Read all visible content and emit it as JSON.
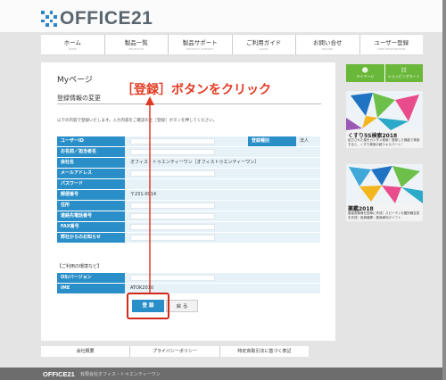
{
  "brand": {
    "logo_text": "OFFICE21",
    "accent": "#2a86c9"
  },
  "nav": {
    "items": [
      {
        "label": "ホーム",
        "sub": "HOME"
      },
      {
        "label": "製品一覧",
        "sub": "PRODUCTS"
      },
      {
        "label": "製品サポート",
        "sub": "PRODUCT SUPPORT"
      },
      {
        "label": "ご利用ガイド",
        "sub": "GUIDE"
      },
      {
        "label": "お問い合せ",
        "sub": "INQUIRY"
      },
      {
        "label": "ユーザー登録",
        "sub": "USER REGISTRATION"
      }
    ]
  },
  "main": {
    "page_title": "Myページ",
    "section_title": "登録情報の変更",
    "intro": "以下の内容で登録いたします。入力内容をご確認の上［登録］ボタンを押してください。",
    "form_rows": [
      {
        "label": "ユーザーID",
        "value": "",
        "input": true
      },
      {
        "label": "お名前／担当者名",
        "value": "",
        "input": true
      },
      {
        "label": "会社名",
        "value": "オフィス・トゥエンティーワン［オフィストゥエンティーワン］",
        "input": false
      },
      {
        "label": "メールアドレス",
        "value": "",
        "input": true
      },
      {
        "label": "パスワード",
        "value": "",
        "input": false
      },
      {
        "label": "郵便番号",
        "value": "〒231-0014",
        "input": false
      },
      {
        "label": "住所",
        "value": "",
        "input": true
      },
      {
        "label": "連絡先電話番号",
        "value": "",
        "input": true
      },
      {
        "label": "FAX番号",
        "value": "",
        "input": true
      },
      {
        "label": "弊社からのお知らせ",
        "value": "",
        "input": true
      }
    ],
    "user_type_label": "登録種別",
    "user_type_value": "法人",
    "usage_note": "【ご利用の環境など】",
    "env_rows": [
      {
        "label": "OS/バージョン",
        "value": "",
        "input": true
      },
      {
        "label": "IME",
        "value": "ATOK2010",
        "input": false
      }
    ],
    "register_button": "登 録",
    "back_button": "戻 る",
    "annotation": "［登録］ボタンをクリック",
    "annotation_color": "#e23a22"
  },
  "sidebar": {
    "buttons": [
      {
        "label": "マイページ",
        "icon": "user-icon"
      },
      {
        "label": "ショッピングカート",
        "icon": "cart-icon"
      }
    ],
    "banners": [
      {
        "title": "くすり5S検索2018",
        "desc": "処方された薬をカンタン検索！登録した機能で検索すると、くすり検索の超エキスパート！"
      },
      {
        "title": "薬鑑2018",
        "desc": "患者用薬情を簡単に作成！スピーディな鑑別報告書を作成！医療機関・薬局様向けソフト"
      }
    ]
  },
  "footer": {
    "links": [
      "会社概要",
      "プライバシーポリシー",
      "特定商取引法に基づく表記"
    ],
    "logo": "OFFICE21",
    "company": "有限会社オフィス・トゥエンティーワン"
  }
}
